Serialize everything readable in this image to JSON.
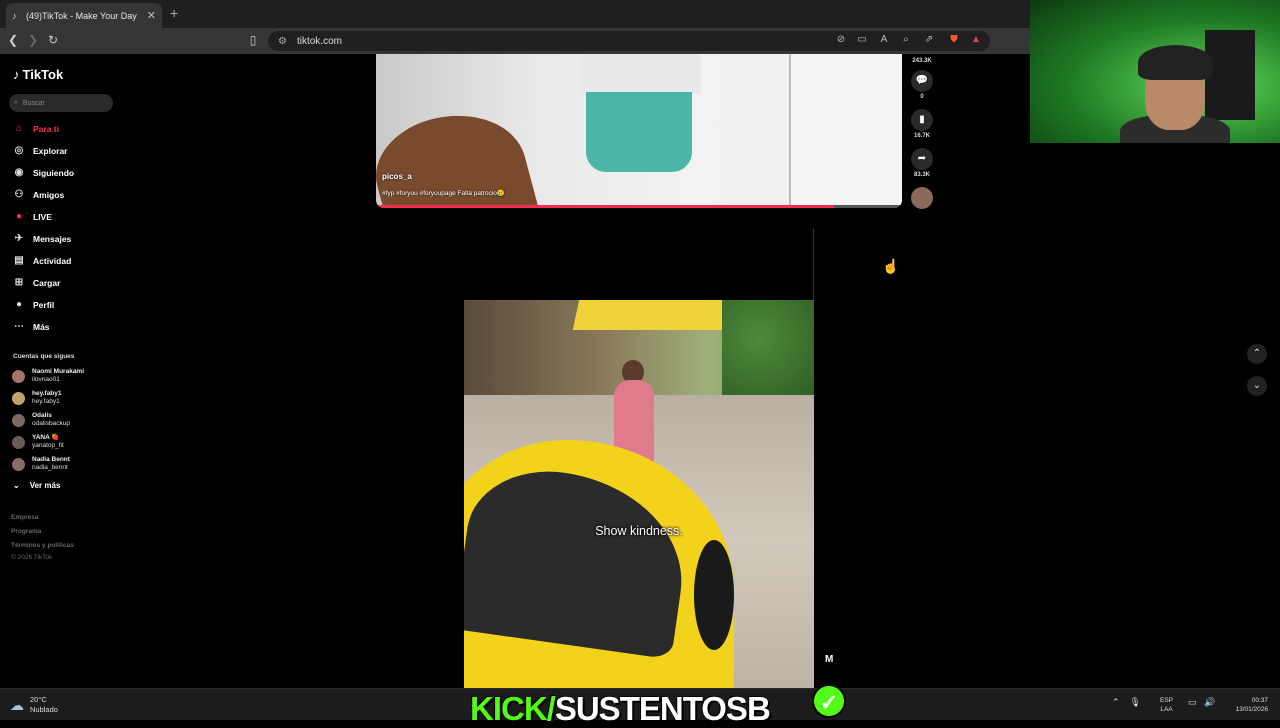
{
  "browser": {
    "tab_title": "(49)TikTok - Make Your Day",
    "url": "tiktok.com"
  },
  "sidebar": {
    "logo": "TikTok",
    "search_placeholder": "Buscar",
    "nav": [
      {
        "label": "Para ti",
        "icon": "home-icon"
      },
      {
        "label": "Explorar",
        "icon": "compass-icon"
      },
      {
        "label": "Siguiendo",
        "icon": "following-icon"
      },
      {
        "label": "Amigos",
        "icon": "friends-icon"
      },
      {
        "label": "LIVE",
        "icon": "live-icon"
      },
      {
        "label": "Mensajes",
        "icon": "messages-icon",
        "badge": "9"
      },
      {
        "label": "Actividad",
        "icon": "activity-icon",
        "badge": "40"
      },
      {
        "label": "Cargar",
        "icon": "upload-icon"
      },
      {
        "label": "Perfil",
        "icon": "profile-icon"
      },
      {
        "label": "Más",
        "icon": "more-icon"
      }
    ],
    "following_title": "Cuentas que sigues",
    "accounts": [
      {
        "name": "Naomi Murakami",
        "username": "ilovnao01"
      },
      {
        "name": "hey.faby1",
        "username": "hey.faby1"
      },
      {
        "name": "Odalis",
        "username": "odalisbackup"
      },
      {
        "name": "YANA 🍓",
        "username": "yanatop_fit"
      },
      {
        "name": "Nadia Bennt",
        "username": "nadia_bennt"
      }
    ],
    "see_more": "Ver más",
    "footer": [
      "Empresa",
      "Programa",
      "Términos y políticas",
      "© 2026 TikTok"
    ]
  },
  "video1": {
    "author": "picos_a",
    "caption": "#fyp #foryou #foryoupage Falta patrocio😢",
    "progress": 0.87,
    "actions": {
      "likes": "243.3K",
      "comments": "0",
      "saves": "16.7K",
      "shares": "83.3K"
    }
  },
  "video2": {
    "subtitle": "Show kindness.",
    "watermark": "M"
  },
  "stream_overlay": {
    "kick_prefix": "KICK/",
    "kick_channel": "SUSTENTOSB",
    "kick_color": "#53fc18"
  },
  "taskbar": {
    "temperature": "20°C",
    "weather": "Nublado",
    "lang_top": "ESP",
    "lang_bottom": "LAA",
    "time": "00:37",
    "date": "13/01/2026"
  }
}
